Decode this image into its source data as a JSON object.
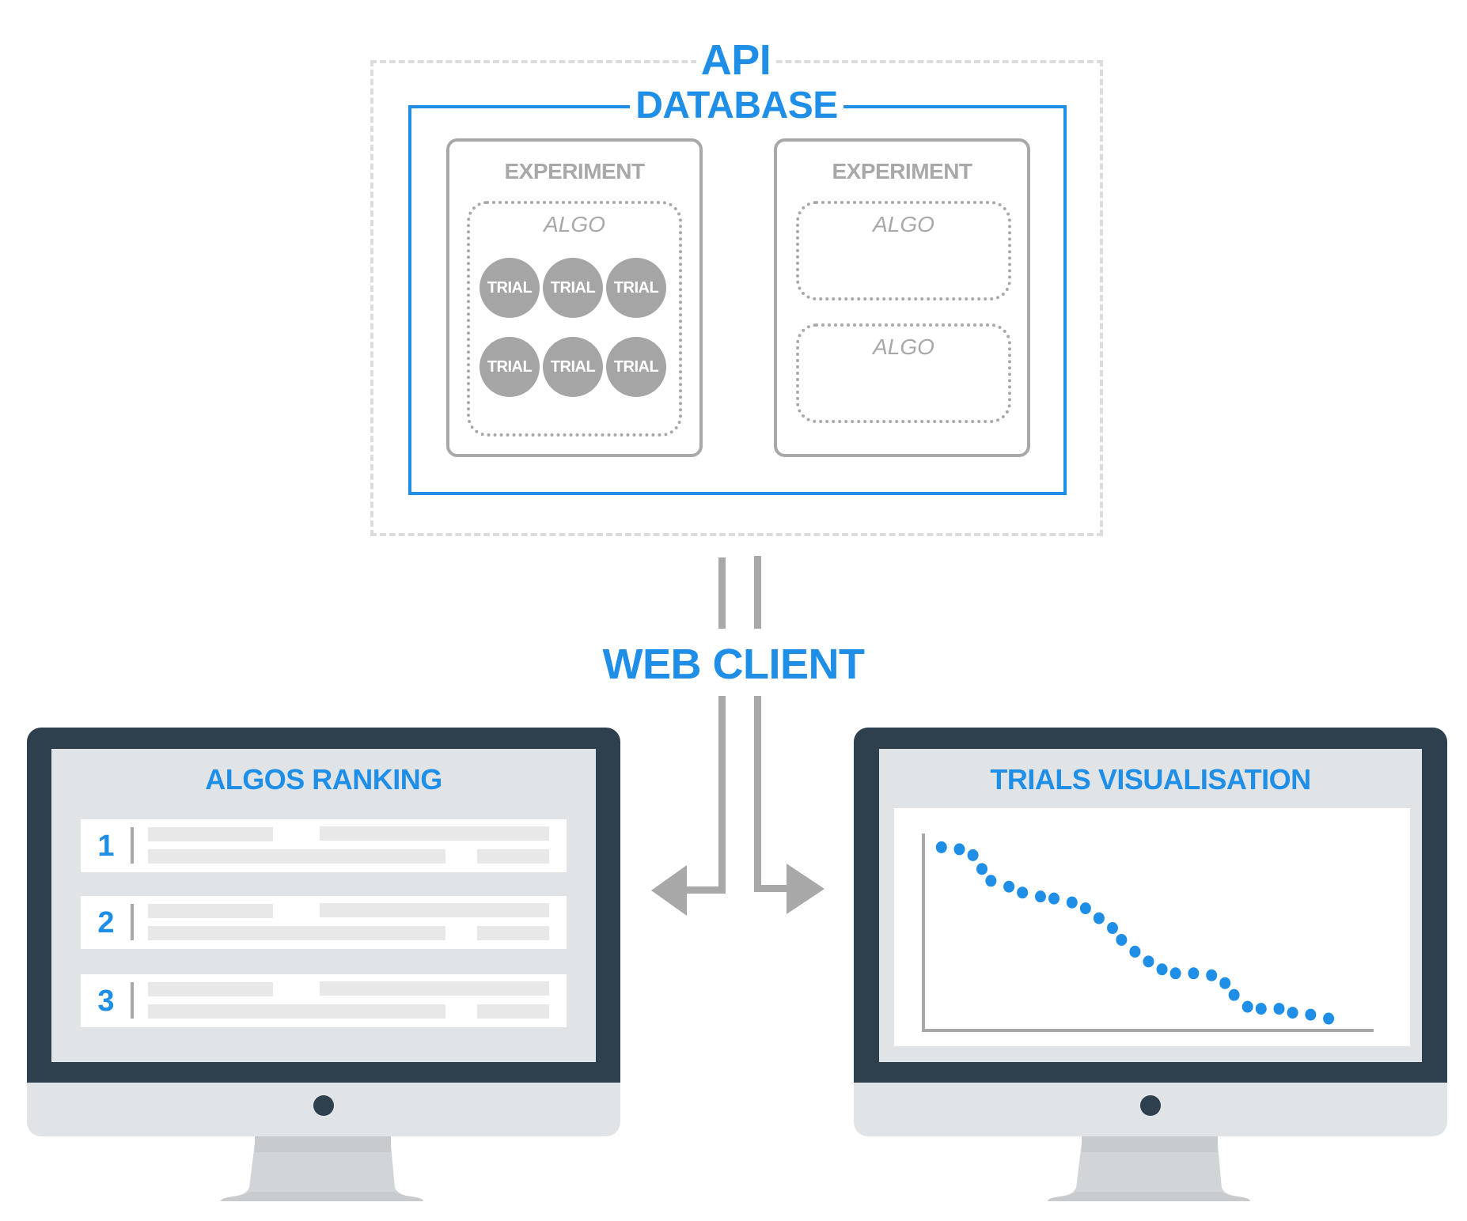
{
  "api": {
    "label": "API"
  },
  "database": {
    "label": "DATABASE"
  },
  "experiments": [
    {
      "title": "EXPERIMENT",
      "algos": [
        {
          "label": "ALGO",
          "trials": [
            "TRIAL",
            "TRIAL",
            "TRIAL",
            "TRIAL",
            "TRIAL",
            "TRIAL"
          ]
        }
      ]
    },
    {
      "title": "EXPERIMENT",
      "algos": [
        {
          "label": "ALGO",
          "trials": []
        },
        {
          "label": "ALGO",
          "trials": []
        }
      ]
    }
  ],
  "web_client": {
    "label": "WEB CLIENT"
  },
  "left_monitor": {
    "title": "ALGOS RANKING",
    "ranks": [
      "1",
      "2",
      "3"
    ]
  },
  "right_monitor": {
    "title": "TRIALS VISUALISATION"
  },
  "colors": {
    "accent": "#1e8ee6",
    "gray": "#a8a8a8",
    "bezel": "#2e3f4e",
    "screen": "#e1e4e7",
    "api_border": "#dcdcdc"
  },
  "chart_data": {
    "type": "scatter",
    "title": "TRIALS VISUALISATION",
    "xlabel": "",
    "ylabel": "",
    "xlim": [
      0,
      1
    ],
    "ylim": [
      0,
      1
    ],
    "grid": false,
    "x": [
      0.04,
      0.08,
      0.11,
      0.13,
      0.15,
      0.19,
      0.22,
      0.26,
      0.29,
      0.33,
      0.36,
      0.39,
      0.42,
      0.44,
      0.47,
      0.5,
      0.53,
      0.56,
      0.6,
      0.64,
      0.67,
      0.69,
      0.72,
      0.75,
      0.79,
      0.82,
      0.86,
      0.9
    ],
    "y": [
      0.93,
      0.92,
      0.89,
      0.82,
      0.76,
      0.73,
      0.7,
      0.68,
      0.67,
      0.65,
      0.62,
      0.57,
      0.52,
      0.46,
      0.4,
      0.35,
      0.31,
      0.29,
      0.29,
      0.28,
      0.24,
      0.18,
      0.12,
      0.11,
      0.11,
      0.09,
      0.08,
      0.06
    ]
  }
}
